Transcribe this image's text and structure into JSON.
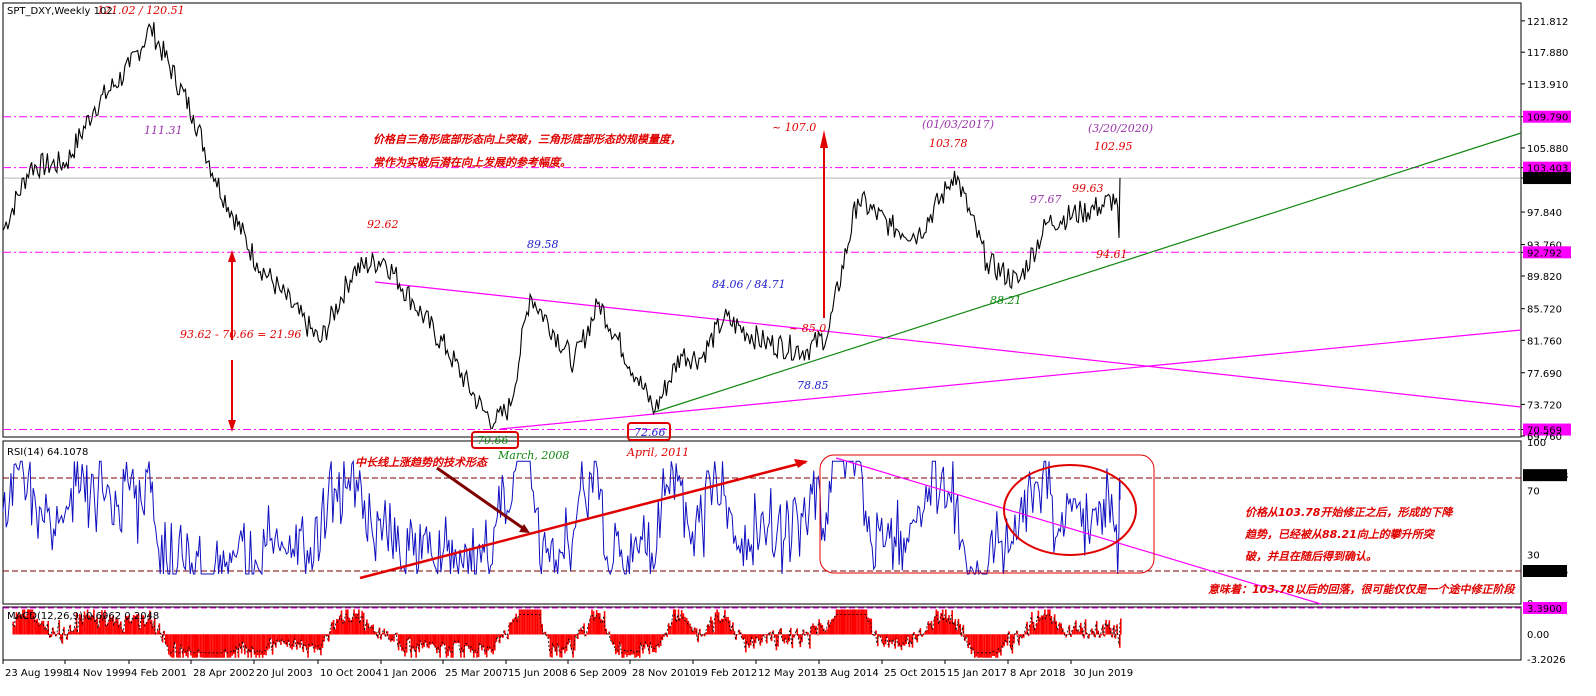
{
  "chart_data": {
    "type": "line",
    "symbol_label": "SPT_DXY,Weekly  102.",
    "main_price_axis": {
      "ylim": [
        69.76,
        123.8
      ],
      "ticks": [
        "121.812",
        "117.880",
        "113.910",
        "109.790",
        "105.880",
        "103.403",
        "102.103",
        "97.840",
        "93.760",
        "92.792",
        "89.820",
        "85.720",
        "81.760",
        "77.690",
        "73.720",
        "70.569",
        "69.760"
      ]
    },
    "price_series": {
      "name": "SPT_DXY",
      "x": [
        "1998-08-23",
        "1999-03",
        "1999-11-14",
        "2000-06",
        "2001-02-04",
        "2001-07",
        "2002-04-28",
        "2002-10",
        "2003-07-20",
        "2004-01",
        "2004-10-10",
        "2005-06",
        "2006-01-01",
        "2006-08",
        "2007-03-25",
        "2007-12",
        "2008-03",
        "2008-06-15",
        "2008-11",
        "2009-09-06",
        "2010-03",
        "2010-11-28",
        "2011-04",
        "2011-10",
        "2012-02-19",
        "2012-08",
        "2013-05-12",
        "2014-03",
        "2014-08-03",
        "2015-03",
        "2015-10-25",
        "2016-05",
        "2016-12",
        "2017-01-15",
        "2017-09",
        "2018-04-08",
        "2018-11",
        "2019-06-30",
        "2019-11",
        "2020-03-01",
        "2020-03-20",
        "2020-03-27"
      ],
      "values": [
        95.5,
        103.5,
        104.0,
        111.0,
        116.0,
        121.0,
        110.0,
        102.0,
        91.5,
        88.0,
        81.5,
        90.5,
        92.0,
        86.5,
        80.5,
        73.0,
        71.5,
        73.5,
        87.5,
        79.0,
        86.5,
        77.0,
        73.0,
        80.0,
        79.5,
        84.5,
        81.5,
        80.5,
        82.5,
        99.5,
        96.0,
        95.0,
        101.0,
        103.0,
        91.5,
        89.0,
        96.5,
        97.8,
        98.5,
        99.6,
        94.6,
        102.1
      ]
    },
    "horizontal_levels": [
      109.79,
      103.403,
      102.103,
      92.792,
      70.569
    ],
    "annotations": {
      "top_high": "121.02 / 120.51",
      "left_high": "111.31",
      "midline_top": "92.62",
      "triangle_mid": "89.58",
      "triangle_right": "84.06 / 84.71",
      "low_2008": "70.66",
      "low_2008_date": "March, 2008",
      "low_2011": "72.66",
      "low_2011_date": "April, 2011",
      "low_2014": "78.85",
      "breakout": "~ 85.0",
      "target": "~ 107.0",
      "peak_date": "(01/03/2017)",
      "peak_value": "103.78",
      "date_2020": "(3/20/2020)",
      "value_2020": "102.95",
      "value_9767": "97.67",
      "value_9963": "99.63",
      "value_9461": "94.61",
      "trend_value": "88.21",
      "measure": "93.62 - 70.66 = 21.96",
      "cn_note_1": "价格自三角形底部形态向上突破，三角形底部形态的规模量度，",
      "cn_note_2": "常作为实破后潜在向上发展的参考幅度。"
    },
    "rsi": {
      "label": "RSI(14) 64.1078",
      "ticks": [
        "100",
        "79.4118",
        "70",
        "30",
        "19.8795",
        "0"
      ],
      "levels": [
        70,
        30
      ],
      "last_value": 64.1078,
      "cn_trend": "中长线上涨趋势的技术形态",
      "cn_note_1": "价格从103.78开始修正之后，形成的下降",
      "cn_note_2": "趋势，已经被从88.21向上的攀升所突",
      "cn_note_3": "破，并且在随后得到确认。",
      "cn_note_4": "意味着：103.78以后的回落，很可能仅仅是一个途中修正阶段"
    },
    "macd": {
      "label": "MACD(12,26,9) 0.6962 0.2048",
      "ticks": [
        "3.3900",
        "0.00",
        "-3.2026"
      ],
      "params": [
        12,
        26,
        9
      ],
      "value": 0.6962,
      "signal": 0.2048
    },
    "x_ticks": [
      "23 Aug 1998",
      "14 Nov 1999",
      "4 Feb 2001",
      "28 Apr 2002",
      "20 Jul 2003",
      "10 Oct 2004",
      "1 Jan 2006",
      "25 Mar 2007",
      "15 Jun 2008",
      "6 Sep 2009",
      "28 Nov 2010",
      "19 Feb 2012",
      "12 May 2013",
      "3 Aug 2014",
      "25 Oct 2015",
      "15 Jan 2017",
      "8 Apr 2018",
      "30 Jun 2019"
    ],
    "colors": {
      "price": "#000000",
      "rsi": "#1010c0",
      "macd_hist": "#ff0000",
      "magenta": "#ff00ff",
      "green_trend": "#008000",
      "annotation_red": "#e00000",
      "annotation_purple": "#9933aa",
      "annotation_blue": "#2222cc",
      "annotation_green": "#118811"
    }
  }
}
